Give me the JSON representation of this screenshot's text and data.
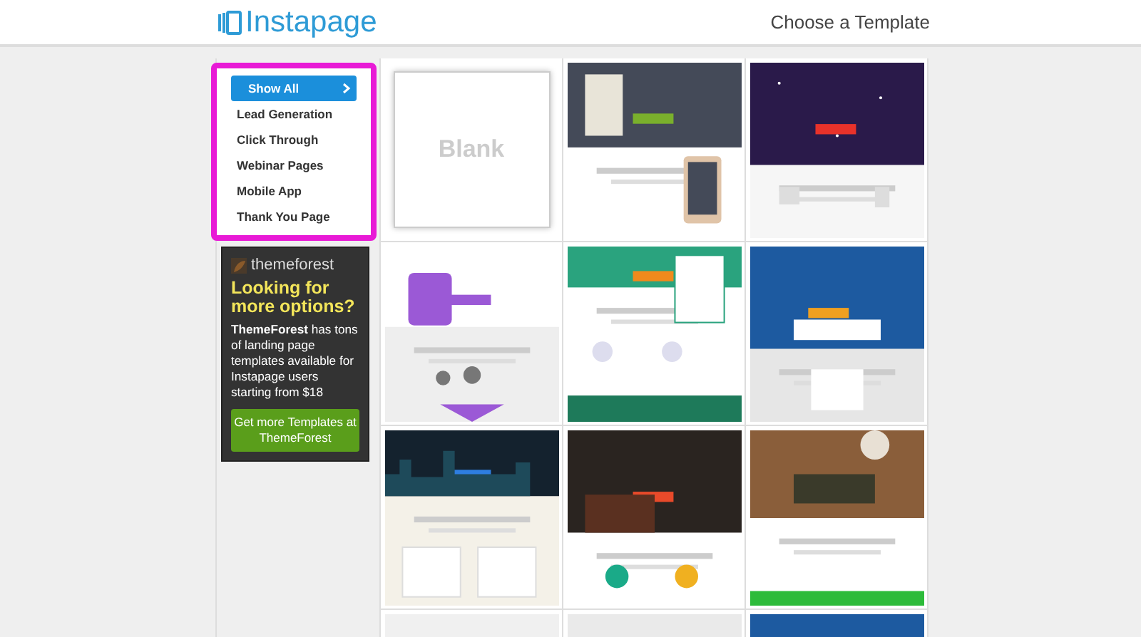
{
  "header": {
    "logo": "Instapage",
    "title": "Choose a Template"
  },
  "categories": [
    {
      "label": "Show All",
      "selected": true
    },
    {
      "label": "Lead Generation",
      "selected": false
    },
    {
      "label": "Click Through",
      "selected": false
    },
    {
      "label": "Webinar Pages",
      "selected": false
    },
    {
      "label": "Mobile App",
      "selected": false
    },
    {
      "label": "Thank You Page",
      "selected": false
    }
  ],
  "promo": {
    "brand": "themeforest",
    "heading": "Looking for more options?",
    "body": "**ThemeForest** has tons of landing page templates available for Instapage users starting from $18",
    "button": "Get more Templates at ThemeForest"
  },
  "templates": [
    {
      "kind": "blank",
      "label": "Blank"
    },
    {
      "kind": "picture"
    },
    {
      "kind": "picture"
    },
    {
      "kind": "picture"
    },
    {
      "kind": "picture"
    },
    {
      "kind": "picture"
    },
    {
      "kind": "picture"
    },
    {
      "kind": "picture"
    },
    {
      "kind": "picture"
    },
    {
      "kind": "picture"
    },
    {
      "kind": "picture"
    },
    {
      "kind": "picture"
    }
  ]
}
